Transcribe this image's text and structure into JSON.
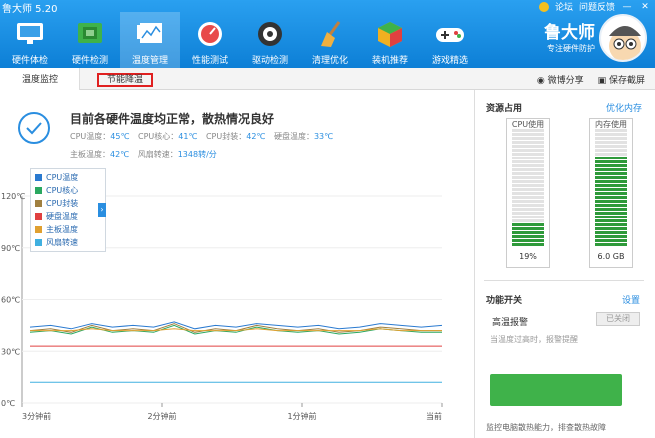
{
  "app": {
    "title": "鲁大师 5.20"
  },
  "topbar": {
    "forum": "论坛",
    "feedback": "问题反馈"
  },
  "nav": [
    {
      "label": "硬件体检",
      "icon": "monitor-icon"
    },
    {
      "label": "硬件检测",
      "icon": "chip-icon"
    },
    {
      "label": "温度管理",
      "icon": "thermometer-icon"
    },
    {
      "label": "性能测试",
      "icon": "speedometer-icon"
    },
    {
      "label": "驱动检测",
      "icon": "gear-icon"
    },
    {
      "label": "清理优化",
      "icon": "broom-icon"
    },
    {
      "label": "装机推荐",
      "icon": "cube-icon"
    },
    {
      "label": "游戏精选",
      "icon": "gamepad-icon"
    }
  ],
  "brand": {
    "name": "鲁大师",
    "tagline": "专注硬件防护"
  },
  "subbar": {
    "tab1": "温度监控",
    "tab2": "节能降温",
    "share": "微博分享",
    "save": "保存截屏"
  },
  "status": {
    "title": "目前各硬件温度均正常，散热情况良好",
    "row1": [
      {
        "label": "CPU温度：",
        "value": "45℃"
      },
      {
        "label": "CPU核心：",
        "value": "41℃"
      },
      {
        "label": "CPU封装：",
        "value": "42℃"
      },
      {
        "label": "硬盘温度：",
        "value": "33℃"
      }
    ],
    "row2": [
      {
        "label": "主板温度：",
        "value": "42℃"
      },
      {
        "label": "风扇转速：",
        "value": "1348转/分"
      }
    ]
  },
  "chart_data": {
    "type": "line",
    "y_ticks": [
      "120℃",
      "90℃",
      "60℃",
      "30℃",
      "0℃"
    ],
    "ylim": [
      0,
      120
    ],
    "x_ticks": [
      "3分钟前",
      "2分钟前",
      "1分钟前",
      "当前"
    ],
    "series": [
      {
        "name": "CPU温度",
        "color": "#2a7ad0",
        "values": [
          44,
          45,
          43,
          46,
          44,
          45,
          44,
          47,
          43,
          45,
          44,
          46,
          45,
          44,
          45,
          43,
          44,
          46,
          45,
          44,
          45
        ]
      },
      {
        "name": "CPU核心",
        "color": "#2aa860",
        "values": [
          41,
          42,
          40,
          44,
          41,
          42,
          41,
          45,
          40,
          42,
          41,
          44,
          42,
          41,
          42,
          40,
          41,
          43,
          42,
          41,
          41
        ]
      },
      {
        "name": "CPU封装",
        "color": "#a08040",
        "values": [
          42,
          43,
          41,
          45,
          42,
          43,
          42,
          46,
          41,
          43,
          42,
          45,
          43,
          42,
          43,
          41,
          42,
          44,
          43,
          42,
          42
        ]
      },
      {
        "name": "硬盘温度",
        "color": "#e04040",
        "values": [
          33,
          33,
          33,
          33,
          33,
          33,
          33,
          33,
          33,
          33,
          33,
          33,
          33,
          33,
          33,
          33,
          33,
          33,
          33,
          33,
          33
        ]
      },
      {
        "name": "主板温度",
        "color": "#e0a030",
        "values": [
          42,
          42,
          42,
          43,
          42,
          42,
          42,
          43,
          42,
          42,
          42,
          43,
          42,
          42,
          42,
          42,
          42,
          43,
          42,
          42,
          42
        ]
      },
      {
        "name": "风扇转速",
        "color": "#40b0e0",
        "values": [
          12,
          12,
          12,
          12,
          12,
          12,
          12,
          12,
          12,
          12,
          12,
          12,
          12,
          12,
          12,
          12,
          12,
          12,
          12,
          12,
          12
        ]
      }
    ]
  },
  "resources": {
    "title": "资源占用",
    "optimize": "优化内存",
    "cpu": {
      "label": "CPU使用",
      "value": "19%",
      "fill": 0.19
    },
    "mem": {
      "label": "内存使用",
      "value": "6.0 GB",
      "fill": 0.75
    }
  },
  "functions": {
    "title": "功能开关",
    "settings": "设置",
    "alarm": "高温报警",
    "alarm_state": "已关闭",
    "alarm_desc": "当温度过高时，报警提醒",
    "bottom_label": "监控电脑散热能力，排查散热故障"
  },
  "colors": {
    "accent": "#1a8ee0",
    "green": "#3fb24a"
  }
}
